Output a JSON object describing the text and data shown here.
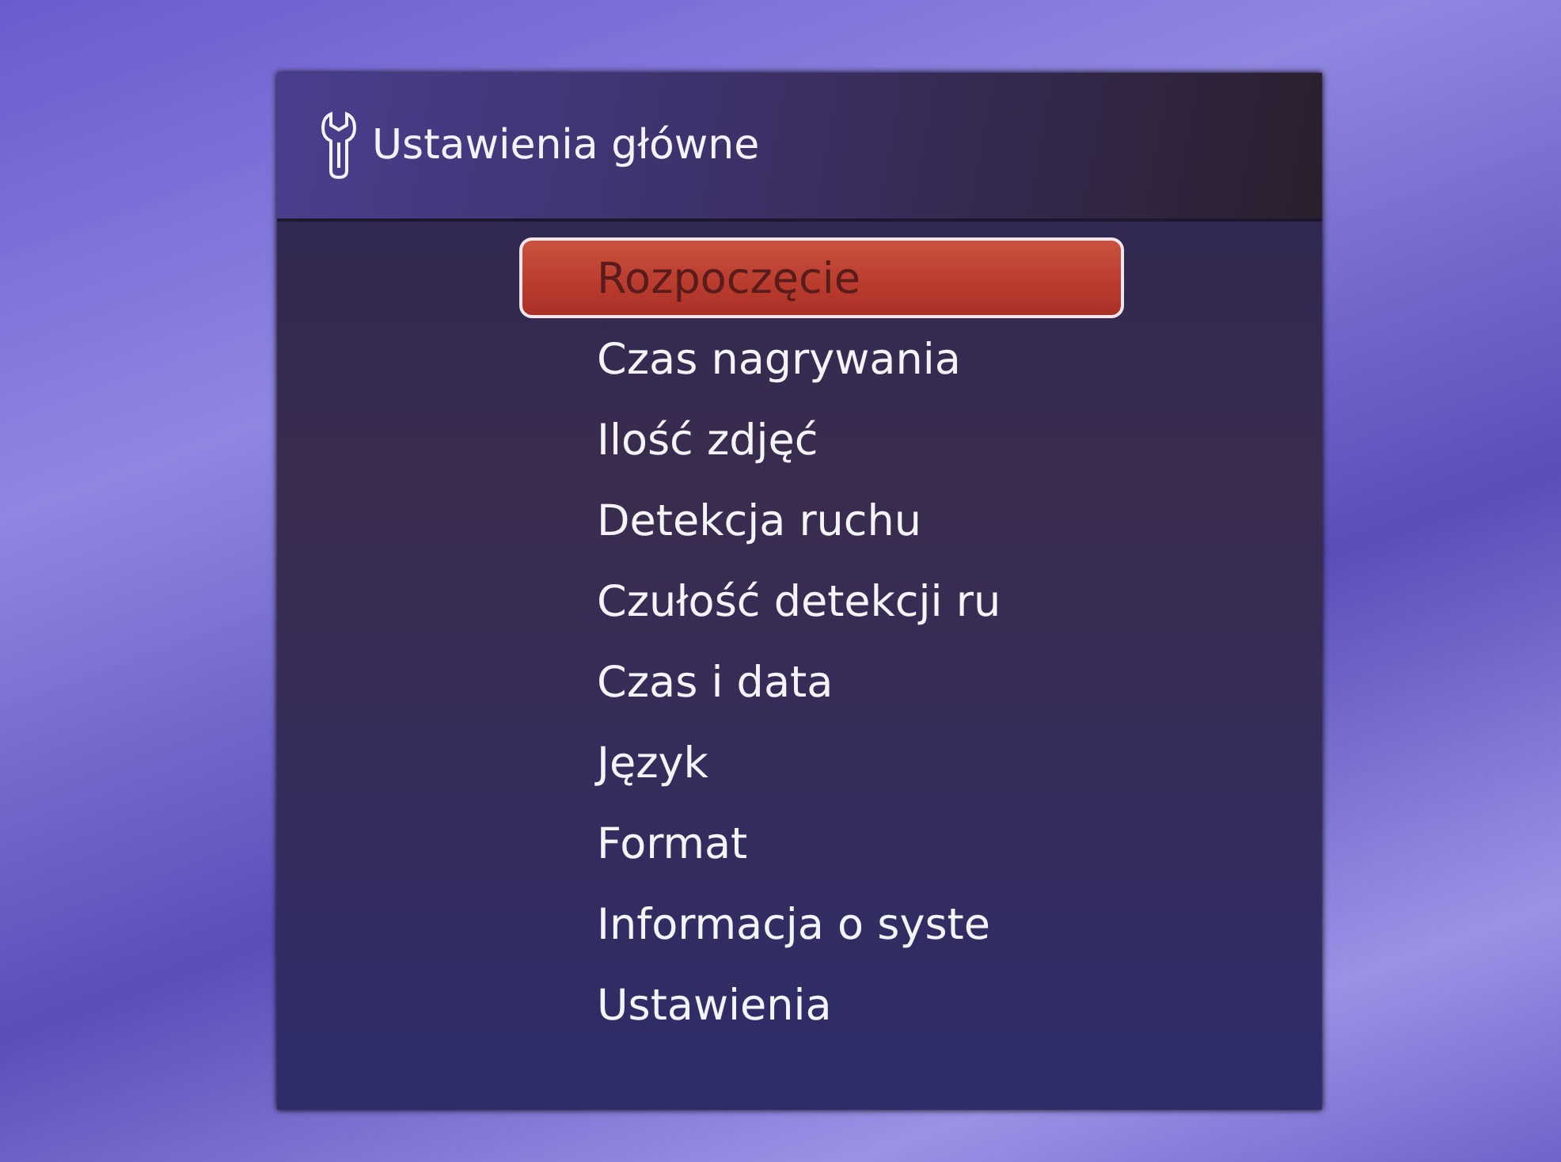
{
  "window": {
    "title": "Ustawienia główne"
  },
  "menu": [
    {
      "label": "Rozpoczęcie",
      "selected": true
    },
    {
      "label": "Czas nagrywania",
      "selected": false
    },
    {
      "label": "Ilość zdjęć",
      "selected": false
    },
    {
      "label": "Detekcja ruchu",
      "selected": false
    },
    {
      "label": "Czułość detekcji ru",
      "selected": false
    },
    {
      "label": "Czas i data",
      "selected": false
    },
    {
      "label": "Język",
      "selected": false
    },
    {
      "label": "Format",
      "selected": false
    },
    {
      "label": "Informacja o syste",
      "selected": false
    },
    {
      "label": "Ustawienia",
      "selected": false
    }
  ]
}
